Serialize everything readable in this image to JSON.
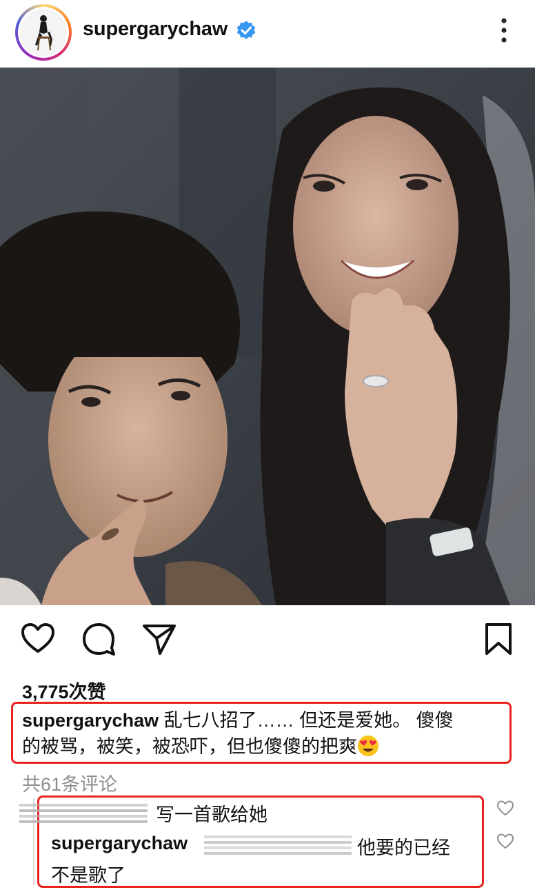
{
  "post": {
    "username": "supergarychaw",
    "verified": true,
    "likes": "3,775次赞",
    "caption_user": "supergarychaw",
    "caption_line1": " 乱七八招了…… 但还是爱她。 傻傻",
    "caption_line2": "的被骂，被笑，被恐吓，但也傻傻的把爽",
    "caption_emoji": "heart-eyes-emoji",
    "comments_count": "共61条评论"
  },
  "comments": [
    {
      "text": "写一首歌给她"
    },
    {
      "user": "supergarychaw",
      "text_line1": "他要的已经",
      "text_line2": "不是歌了"
    }
  ],
  "icons": {
    "like": "heart-icon",
    "comment": "comment-bubble-icon",
    "share": "paper-plane-icon",
    "save": "bookmark-icon",
    "more": "more-vertical-icon",
    "verified": "verified-badge-icon"
  },
  "colors": {
    "highlight": "#e8221e",
    "verified": "#3897f0",
    "muted": "#8e8e8e"
  }
}
